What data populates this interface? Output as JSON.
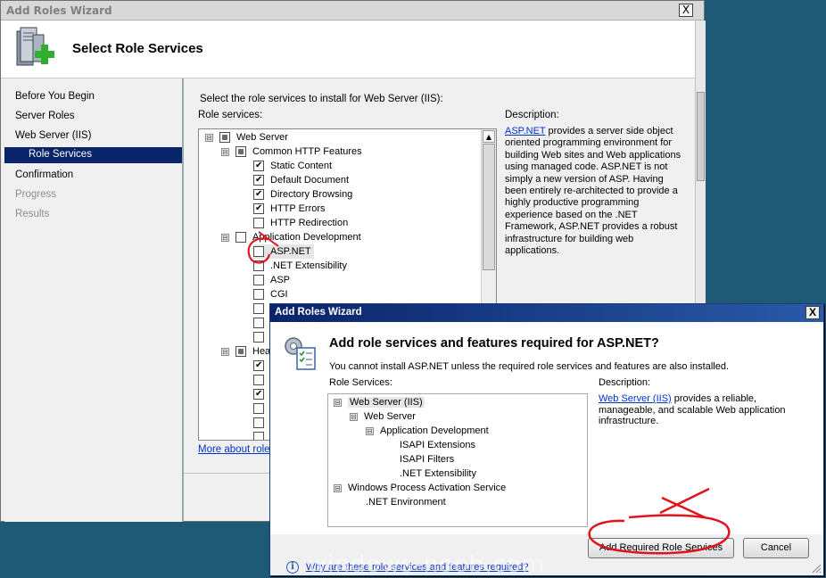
{
  "main_window": {
    "title": "Add Roles Wizard",
    "close_label": "X",
    "header_title": "Select Role Services"
  },
  "nav": {
    "items": [
      {
        "label": "Before You Begin"
      },
      {
        "label": "Server Roles"
      },
      {
        "label": "Web Server (IIS)"
      },
      {
        "label": "Role Services"
      },
      {
        "label": "Confirmation"
      },
      {
        "label": "Progress"
      },
      {
        "label": "Results"
      }
    ]
  },
  "content": {
    "instruction": "Select the role services to install for Web Server (IIS):",
    "role_services_label": "Role services:",
    "description_label": "Description:",
    "description_link": "ASP.NET",
    "description_body": " provides a server side object oriented programming environment for building Web sites and Web applications using managed code. ASP.NET is not simply a new version of ASP. Having been entirely re-architected to provide a highly productive programming experience based on the .NET Framework, ASP.NET provides a robust infrastructure for building web applications.",
    "more_link": "More about role"
  },
  "tree": [
    {
      "label": "Web Server",
      "state": "partial",
      "expander": "⊟"
    },
    {
      "label": "Common HTTP Features",
      "state": "partial",
      "expander": "⊟"
    },
    {
      "label": "Static Content",
      "state": "checked"
    },
    {
      "label": "Default Document",
      "state": "checked"
    },
    {
      "label": "Directory Browsing",
      "state": "checked"
    },
    {
      "label": "HTTP Errors",
      "state": "checked"
    },
    {
      "label": "HTTP Redirection",
      "state": "unchecked"
    },
    {
      "label": "Application Development",
      "state": "unchecked",
      "expander": "⊟"
    },
    {
      "label": "ASP.NET",
      "state": "unchecked"
    },
    {
      "label": ".NET Extensibility",
      "state": "unchecked"
    },
    {
      "label": "ASP",
      "state": "unchecked"
    },
    {
      "label": "CGI",
      "state": "unchecked"
    },
    {
      "label": "Hea",
      "state": "partial",
      "expander": "⊟"
    }
  ],
  "dialog": {
    "title": "Add Roles Wizard",
    "close_label": "X",
    "heading": "Add role services and features required for ASP.NET?",
    "subtext": "You cannot install ASP.NET unless the required role services and features are also installed.",
    "role_services_label": "Role Services:",
    "description_label": "Description:",
    "description_link": "Web Server (IIS)",
    "description_body": " provides a reliable, manageable, and scalable Web application infrastructure.",
    "tree": [
      {
        "label": "Web Server (IIS)",
        "expander": "⊟"
      },
      {
        "label": "Web Server",
        "expander": "⊟"
      },
      {
        "label": "Application Development",
        "expander": "⊟"
      },
      {
        "label": "ISAPI Extensions"
      },
      {
        "label": "ISAPI Filters"
      },
      {
        "label": ".NET Extensibility"
      },
      {
        "label": "Windows Process Activation Service",
        "expander": "⊟"
      },
      {
        "label": ".NET Environment"
      }
    ],
    "add_button": "Add Required Role Services",
    "cancel_button": "Cancel",
    "info_link": "Why are these role services and features required?"
  },
  "watermark": "windows-noob.com",
  "colors": {
    "selection": "#0a246a",
    "link": "#0033cc",
    "annotation_red": "#e0141e",
    "desktop": "#1e5a76"
  }
}
